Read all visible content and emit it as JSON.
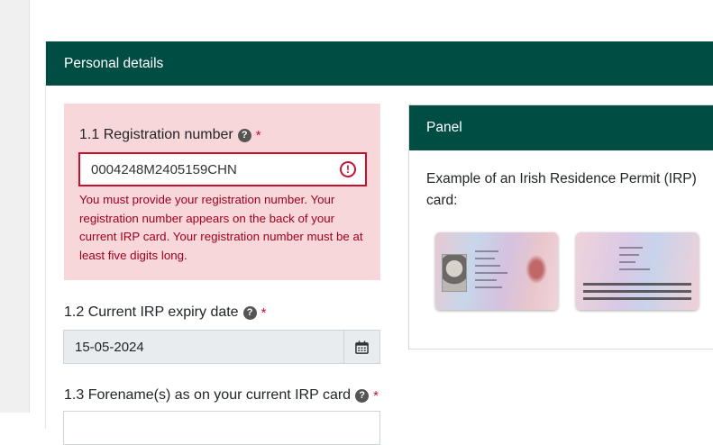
{
  "card": {
    "title": "Personal details"
  },
  "fields": {
    "registration": {
      "label": "1.1 Registration number",
      "required_mark": "*",
      "value": "0004248M2405159CHN",
      "error": "You must provide your registration number. Your registration number appears on the back of your current IRP card. Your registration number must be at least five digits long."
    },
    "expiry": {
      "label": "1.2 Current IRP expiry date",
      "required_mark": "*",
      "value": "15-05-2024"
    },
    "forename": {
      "label": "1.3 Forename(s) as on your current IRP card",
      "required_mark": "*"
    }
  },
  "panel": {
    "title": "Panel",
    "text": "Example of an Irish Residence Permit (IRP) card:"
  },
  "icons": {
    "help": "help-circle-icon",
    "error": "exclamation-circle-icon",
    "calendar": "calendar-icon"
  },
  "colors": {
    "header_bg": "#004d44",
    "error_bg": "#f8d7da",
    "error_text": "#a0001e",
    "error_border": "#c8102e"
  }
}
